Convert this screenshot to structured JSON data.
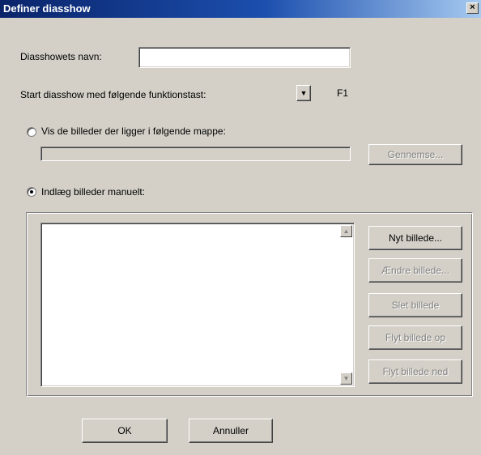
{
  "window": {
    "title": "Definer diasshow",
    "close_glyph": "×"
  },
  "name_field": {
    "label": "Diasshowets navn:",
    "value": ""
  },
  "function_key": {
    "label": "Start diasshow med følgende funktionstast:",
    "selected": "F1",
    "arrow": "▼"
  },
  "folder_option": {
    "label": "Vis de billeder der ligger i følgende mappe:",
    "path_value": "",
    "browse_label": "Gennemse...",
    "selected": false
  },
  "manual_option": {
    "label": "Indlæg billeder manuelt:",
    "selected": true
  },
  "image_list": {
    "items": [],
    "scroll_up": "▲",
    "scroll_down": "▼"
  },
  "actions": {
    "new_label": "Nyt billede...",
    "edit_label": "Ændre billede...",
    "delete_label": "Slet billede",
    "move_up_label": "Flyt billede op",
    "move_down_label": "Flyt billede ned"
  },
  "footer": {
    "ok_label": "OK",
    "cancel_label": "Annuller"
  }
}
